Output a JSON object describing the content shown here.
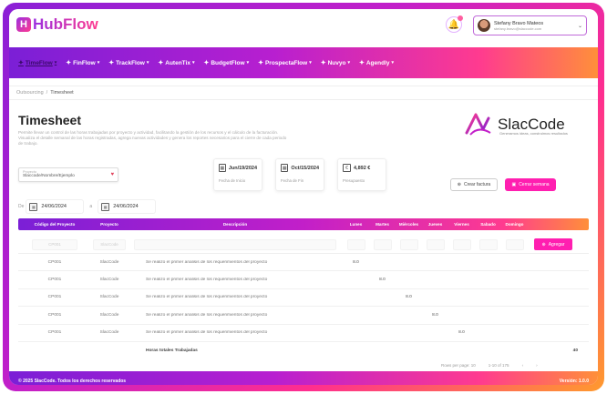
{
  "app": {
    "name": "HubFlow",
    "logo_letter": "H"
  },
  "user": {
    "name": "Stefany Bravo Mateos",
    "role": "stefany.bravo@slaccode.com"
  },
  "nav": [
    {
      "label": "TimeFlow",
      "icon": "✦",
      "active": true
    },
    {
      "label": "FinFlow",
      "icon": "✦",
      "active": false
    },
    {
      "label": "TrackFlow",
      "icon": "✦",
      "active": false
    },
    {
      "label": "AutenTix",
      "icon": "✦",
      "active": false
    },
    {
      "label": "BudgetFlow",
      "icon": "✦",
      "active": false
    },
    {
      "label": "ProspectaFlow",
      "icon": "✦",
      "active": false
    },
    {
      "label": "Nuvyo",
      "icon": "✦",
      "active": false
    },
    {
      "label": "Agendly",
      "icon": "✦",
      "active": false
    }
  ],
  "breadcrumb": {
    "parent": "Outsourcing",
    "current": "Timesheet"
  },
  "page": {
    "title": "Timesheet",
    "description": "Permite llevar un control de las horas trabajadas por proyecto y actividad, facilitando la gestión de los recursos y el cálculo de la facturación. Visualiza el detalle semanal de las horas registradas, agrega nuevas actividades y genera los reportes necesarios para el cierre de cada periodo de trabajo."
  },
  "brand": {
    "name": "SlacCode",
    "tagline": "Generamos ideas, construimos resultados"
  },
  "project_select": {
    "label": "Proyecto",
    "value": "Slaccode/Nombre/Ejemplo",
    "icon": "heart-icon"
  },
  "cards": [
    {
      "value": "Jun/19/2024",
      "label": "Fecha de Inicio",
      "icon": "calendar-icon"
    },
    {
      "value": "Oct/15/2024",
      "label": "Fecha de Fin",
      "icon": "calendar-icon"
    },
    {
      "value": "4,892 €",
      "label": "Presupuesto",
      "icon": "money-icon"
    }
  ],
  "actions": {
    "invoice": "Crear factura",
    "close_week": "Cerrar semana"
  },
  "dates": {
    "from_label": "De",
    "from": "24/06/2024",
    "to_label": "a",
    "to": "24/06/2024"
  },
  "table": {
    "headers": [
      "Código del Proyecto",
      "Proyecto",
      "Descripción",
      "Lunes",
      "Martes",
      "Miércoles",
      "Jueves",
      "Viernes",
      "Sabado",
      "Domingo"
    ],
    "input_placeholders": {
      "code": "CP001",
      "project": "SlacCode"
    },
    "add_label": "Agregar",
    "rows": [
      {
        "code": "CP001",
        "project": "SlacCode",
        "desc": "Se realizo el primer analisis de los requerimientos del proyecto",
        "days": [
          "8.0",
          "",
          "",
          "",
          "",
          "",
          ""
        ]
      },
      {
        "code": "CP001",
        "project": "SlacCode",
        "desc": "Se realizo el primer analisis de los requerimientos del proyecto",
        "days": [
          "",
          "8.0",
          "",
          "",
          "",
          "",
          ""
        ]
      },
      {
        "code": "CP001",
        "project": "SlacCode",
        "desc": "Se realizo el primer analisis de los requerimientos del proyecto",
        "days": [
          "",
          "",
          "8.0",
          "",
          "",
          "",
          ""
        ]
      },
      {
        "code": "CP001",
        "project": "SlacCode",
        "desc": "Se realizo el primer analisis de los requerimientos del proyecto",
        "days": [
          "",
          "",
          "",
          "8.0",
          "",
          "",
          ""
        ]
      },
      {
        "code": "CP001",
        "project": "SlacCode",
        "desc": "Se realizo el primer analisis de los requerimientos del proyecto",
        "days": [
          "",
          "",
          "",
          "",
          "8.0",
          "",
          ""
        ]
      }
    ],
    "total_label": "Horas totales Trabajadas",
    "total_value": "40"
  },
  "pager": {
    "rows_label": "Rows per page: 10",
    "range": "1-10 of 175",
    "prev": "‹",
    "next": "›"
  },
  "footer": {
    "copyright": "© 2025 SlacCode. Todos los derechos reservados",
    "version": "Versión: 1.0.0"
  }
}
